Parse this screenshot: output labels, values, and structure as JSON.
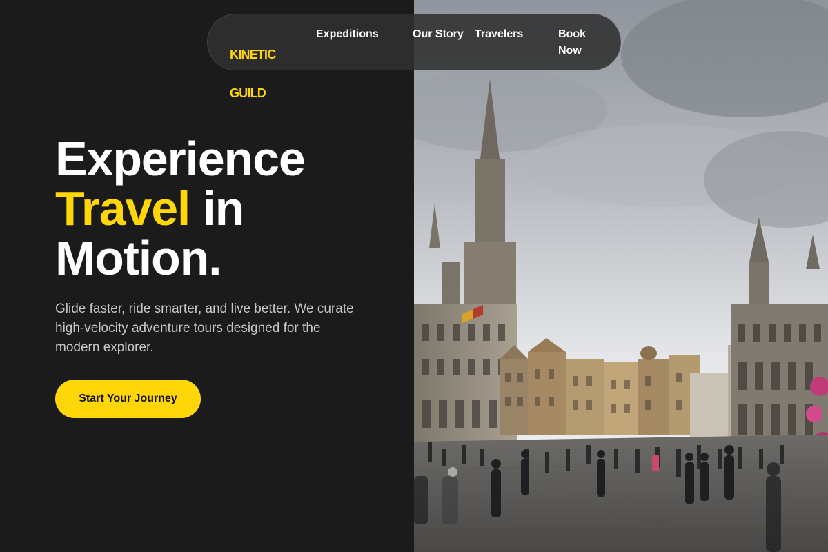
{
  "brand": {
    "logo_line1": "KINETIC",
    "logo_line2": "GUILD",
    "accent_color": "#ffd60a"
  },
  "nav": {
    "items": [
      {
        "label": "Expeditions"
      },
      {
        "label": "Our Story"
      },
      {
        "label": "Travelers"
      },
      {
        "label": "Book Now"
      }
    ]
  },
  "hero": {
    "title_line1": "Experience",
    "title_accent": "Travel",
    "title_line2_rest": " in",
    "title_line3": "Motion.",
    "subtitle": "Glide faster, ride smarter, and live better. We curate high-velocity adventure tours designed for the modern explorer.",
    "cta_label": "Start Your Journey"
  },
  "colors": {
    "background": "#1b1b1b",
    "text": "#ffffff",
    "muted": "#c8c8c8"
  }
}
